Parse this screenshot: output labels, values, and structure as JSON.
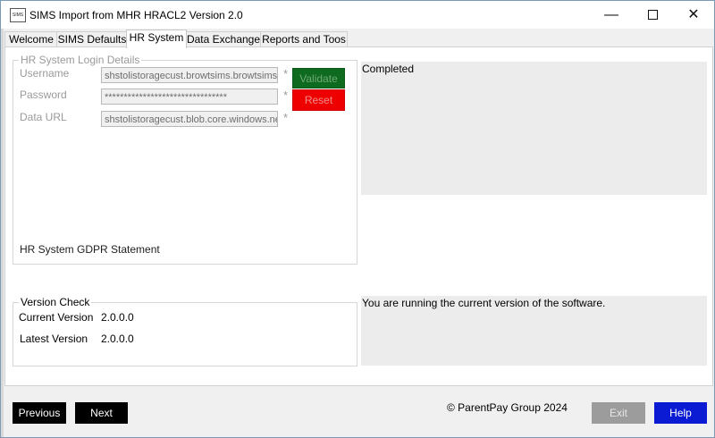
{
  "window": {
    "title": "SIMS Import from MHR HRACL2 Version 2.0",
    "icon_text": "SIMS",
    "controls": {
      "minimize": "—",
      "close": "✕"
    }
  },
  "tabs": [
    {
      "label": "Welcome"
    },
    {
      "label": "SIMS Defaults"
    },
    {
      "label": "HR System"
    },
    {
      "label": "Data Exchange"
    },
    {
      "label": "Reports and Toos"
    }
  ],
  "hr_login": {
    "legend": "HR System Login Details",
    "username_label": "Username",
    "username_value": "shstolistoragecust.browtsims.browtsims",
    "password_label": "Password",
    "password_value": "********************************",
    "data_url_label": "Data URL",
    "data_url_value": "shstolistoragecust.blob.core.windows.net",
    "required_marker": "*",
    "validate_label": "Validate",
    "reset_label": "Reset",
    "gdpr_label": "HR System GDPR Statement"
  },
  "status_panel": {
    "text": "Completed"
  },
  "version_check": {
    "legend": "Version Check",
    "current_label": "Current Version",
    "current_value": "2.0.0.0",
    "latest_label": "Latest Version",
    "latest_value": "2.0.0.0"
  },
  "version_panel": {
    "text": "You are running the current version of the software."
  },
  "footer": {
    "previous_label": "Previous",
    "next_label": "Next",
    "copyright": "© ParentPay Group 2024",
    "exit_label": "Exit",
    "help_label": "Help"
  }
}
